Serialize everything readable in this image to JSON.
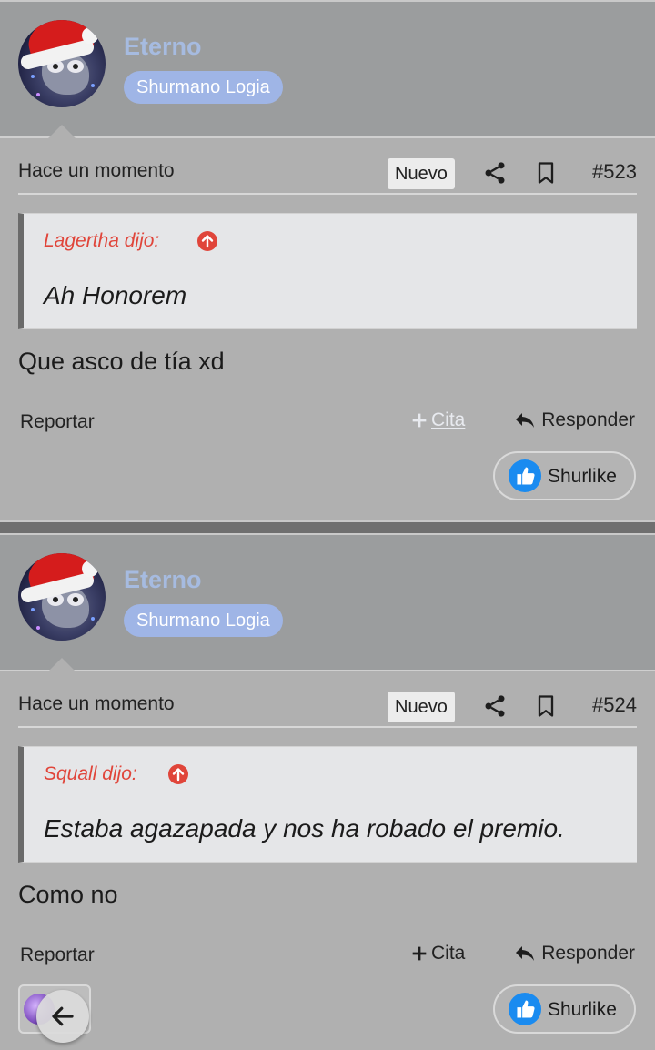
{
  "posts": [
    {
      "username": "Eterno",
      "role": "Shurmano Logia",
      "timestamp": "Hace un momento",
      "new_label": "Nuevo",
      "post_number": "#523",
      "quote_author": "Lagertha dijo:",
      "quote_text": "Ah Honorem",
      "message": "Que asco de tía xd",
      "report_label": "Reportar",
      "quote_label": "Cita",
      "reply_label": "Responder",
      "like_label": "Shurlike"
    },
    {
      "username": "Eterno",
      "role": "Shurmano Logia",
      "timestamp": "Hace un momento",
      "new_label": "Nuevo",
      "post_number": "#524",
      "quote_author": "Squall dijo:",
      "quote_text": "Estaba agazapada y nos ha robado el premio.",
      "message": "Como no",
      "report_label": "Reportar",
      "quote_label": "Cita",
      "reply_label": "Responder",
      "like_label": "Shurlike"
    }
  ],
  "icons": {
    "share": "share-icon",
    "bookmark": "bookmark-icon",
    "quote_up": "arrow-up-circle-icon",
    "plus": "plus-icon",
    "reply": "reply-icon",
    "like": "thumbs-up-icon",
    "back": "arrow-left-icon"
  },
  "colors": {
    "user_bar": "#9b9d9e",
    "post_bg": "#b0b0b0",
    "username": "#a6bbe0",
    "role_badge": "#9fb5e6",
    "quote_author": "#e0453a",
    "like_blue": "#1a8bf0"
  }
}
